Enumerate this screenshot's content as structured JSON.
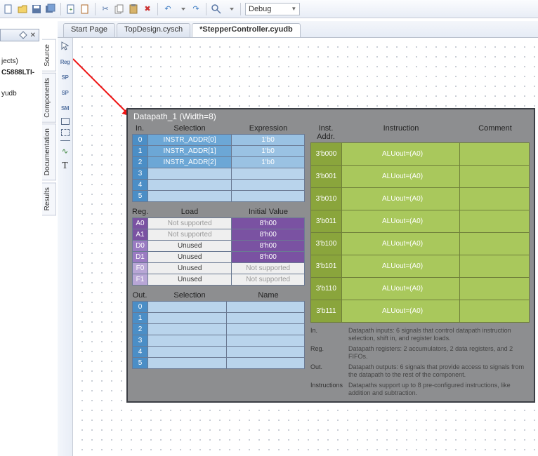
{
  "toolbar": {
    "config_label": "Debug"
  },
  "proj": {
    "line1": "jects)",
    "line2": "C5888LTI-",
    "line3": "yudb"
  },
  "side_tabs": [
    "Source",
    "Components",
    "Documentation",
    "Results"
  ],
  "doc_tabs": [
    {
      "label": "Start Page",
      "active": false
    },
    {
      "label": "TopDesign.cysch",
      "active": false
    },
    {
      "label": "*StepperController.cyudb",
      "active": true
    }
  ],
  "datapath": {
    "title": "Datapath_1 (Width=8)",
    "in_head": {
      "col0": "In.",
      "col1": "Selection",
      "col2": "Expression"
    },
    "in_rows": [
      {
        "idx": "0",
        "sel": "INSTR_ADDR[0]",
        "exp": "1'b0"
      },
      {
        "idx": "1",
        "sel": "INSTR_ADDR[1]",
        "exp": "1'b0"
      },
      {
        "idx": "2",
        "sel": "INSTR_ADDR[2]",
        "exp": "1'b0"
      },
      {
        "idx": "3",
        "sel": "",
        "exp": ""
      },
      {
        "idx": "4",
        "sel": "",
        "exp": ""
      },
      {
        "idx": "5",
        "sel": "",
        "exp": ""
      }
    ],
    "reg_head": {
      "col0": "Reg.",
      "col1": "Load",
      "col2": "Initial Value"
    },
    "reg_rows": [
      {
        "idx": "A0",
        "cls": "reg-a",
        "load": "Not supported",
        "init": "8'h00",
        "icls": "p"
      },
      {
        "idx": "A1",
        "cls": "reg-a",
        "load": "Not supported",
        "init": "8'h00",
        "icls": "p"
      },
      {
        "idx": "D0",
        "cls": "reg-d",
        "load": "Unused",
        "init": "8'h00",
        "icls": "p"
      },
      {
        "idx": "D1",
        "cls": "reg-d",
        "load": "Unused",
        "init": "8'h00",
        "icls": "p"
      },
      {
        "idx": "F0",
        "cls": "reg-f",
        "load": "Unused",
        "init": "Not supported",
        "icls": "g"
      },
      {
        "idx": "F1",
        "cls": "reg-f",
        "load": "Unused",
        "init": "Not supported",
        "icls": "g"
      }
    ],
    "out_head": {
      "col0": "Out.",
      "col1": "Selection",
      "col2": "Name"
    },
    "out_rows": [
      "0",
      "1",
      "2",
      "3",
      "4",
      "5"
    ],
    "inst_head": {
      "col0": "Inst. Addr.",
      "col1": "Instruction",
      "col2": "Comment"
    },
    "inst_rows": [
      {
        "addr": "3'b000",
        "ins": "ALUout=(A0)"
      },
      {
        "addr": "3'b001",
        "ins": "ALUout=(A0)"
      },
      {
        "addr": "3'b010",
        "ins": "ALUout=(A0)"
      },
      {
        "addr": "3'b011",
        "ins": "ALUout=(A0)"
      },
      {
        "addr": "3'b100",
        "ins": "ALUout=(A0)"
      },
      {
        "addr": "3'b101",
        "ins": "ALUout=(A0)"
      },
      {
        "addr": "3'b110",
        "ins": "ALUout=(A0)"
      },
      {
        "addr": "3'b111",
        "ins": "ALUout=(A0)"
      }
    ],
    "desc": {
      "in_k": "In.",
      "in_v": "Datapath inputs: 6 signals that control datapath instruction selection, shift in, and register loads.",
      "reg_k": "Reg.",
      "reg_v": "Datapath registers: 2 accumulators, 2 data registers, and 2 FIFOs.",
      "out_k": "Out.",
      "out_v": "Datapath outputs: 6 signals that provide access to signals from the datapath to the rest of the component.",
      "ins_k": "Instructions",
      "ins_v": "Datapaths support up to 8 pre-configured instructions, like addition and subtraction."
    }
  }
}
